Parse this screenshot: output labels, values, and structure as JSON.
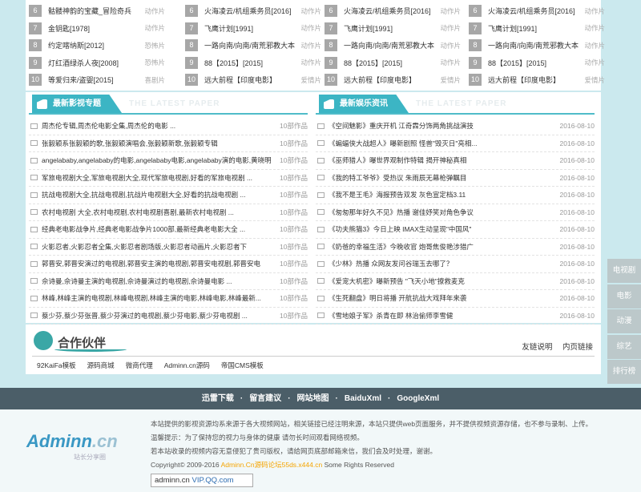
{
  "ranks": [
    [
      {
        "num": "6",
        "title": "骷髅神韵的宝藏_冒险奇兵",
        "genre": "动作片"
      },
      {
        "num": "7",
        "title": "金钥匙[1978]",
        "genre": "动作片"
      },
      {
        "num": "8",
        "title": "约定喀纳斯[2012]",
        "genre": "恐怖片"
      },
      {
        "num": "9",
        "title": "灯红酒绿杀人夜[2008]",
        "genre": "恐怖片"
      },
      {
        "num": "10",
        "title": "等爱归来/盗婴[2015]",
        "genre": "喜剧片"
      }
    ],
    [
      {
        "num": "6",
        "title": "火海凌云/机组乘务员[2016]",
        "genre": "动作片"
      },
      {
        "num": "7",
        "title": "飞鹰计划[1991]",
        "genre": "动作片"
      },
      {
        "num": "8",
        "title": "一路向南/向南/南荒邪教大本",
        "genre": "动作片"
      },
      {
        "num": "9",
        "title": "88【2015】[2015]",
        "genre": "动作片"
      },
      {
        "num": "10",
        "title": "远大前程【印度电影】",
        "genre": "爱情片"
      }
    ],
    [
      {
        "num": "6",
        "title": "火海凌云/机组乘务员[2016]",
        "genre": "动作片"
      },
      {
        "num": "7",
        "title": "飞鹰计划[1991]",
        "genre": "动作片"
      },
      {
        "num": "8",
        "title": "一路向南/向南/南荒邪教大本",
        "genre": "动作片"
      },
      {
        "num": "9",
        "title": "88【2015】[2015]",
        "genre": "动作片"
      },
      {
        "num": "10",
        "title": "远大前程【印度电影】",
        "genre": "爱情片"
      }
    ],
    [
      {
        "num": "6",
        "title": "火海凌云/机组乘务员[2016]",
        "genre": "动作片"
      },
      {
        "num": "7",
        "title": "飞鹰计划[1991]",
        "genre": "动作片"
      },
      {
        "num": "8",
        "title": "一路向南/向南/南荒邪教大本",
        "genre": "动作片"
      },
      {
        "num": "9",
        "title": "88【2015】[2015]",
        "genre": "动作片"
      },
      {
        "num": "10",
        "title": "远大前程【印度电影】",
        "genre": "爱情片"
      }
    ]
  ],
  "topics": {
    "title": "最新影视专题",
    "ghost": "THE LATEST PAPER",
    "items": [
      {
        "title": "周杰伦专辑,周杰伦电影全集,周杰伦的电影 ...",
        "meta": "10部作品"
      },
      {
        "title": "张毅颖系张毅颖的歌,张毅颖演唱会,张毅颖新歌,张毅颖专辑",
        "meta": "10部作品"
      },
      {
        "title": "angelababy,angelababy的电影,angelababy电影,angelababy演的电影,黄晓明",
        "meta": "10部作品"
      },
      {
        "title": "军旅电视剧大全,军旅电视剧大全,现代军旅电视剧,好看的军旅电视剧 ...",
        "meta": "10部作品"
      },
      {
        "title": "抗战电视剧大全,抗战电视剧,抗战片电视剧大全,好看的抗战电视剧 ...",
        "meta": "10部作品"
      },
      {
        "title": "农村电视剧 大全,农村电视剧,农村电视剧喜剧,最新农村电视剧 ...",
        "meta": "10部作品"
      },
      {
        "title": "经典老电影战争片,经典老电影战争片1000部,最新经典老电影大全 ...",
        "meta": "10部作品"
      },
      {
        "title": "火影忍者,火影忍者全集,火影忍者剧场版,火影忍者动画片,火影忍者下",
        "meta": "10部作品"
      },
      {
        "title": "郭晋安,郭晋安演过的电视剧,郭晋安主演的电视剧,郭晋安电视剧,郭晋安电",
        "meta": "10部作品"
      },
      {
        "title": "佘诗曼,佘诗曼主演的电视剧,佘诗曼演过的电视剧,佘诗曼电影 ...",
        "meta": "10部作品"
      },
      {
        "title": "林峰,林峰主演的电视剧,林峰电视剧,林峰主演的电影,林峰电影,林峰最新...",
        "meta": "10部作品"
      },
      {
        "title": "蔡少芬,蔡少芬张晋,蔡少芬演过的电视剧,蔡少芬电影,蔡少芬电视剧 ...",
        "meta": "10部作品"
      }
    ]
  },
  "news": {
    "title": "最新娱乐资讯",
    "ghost": "THE LATEST PAPER",
    "items": [
      {
        "title": "《空间魅影》重庆开机 江奇霖分饰两角挑战演技",
        "meta": "2016-08-10"
      },
      {
        "title": "《蝙蝠侠大战超人》曝新剧照 怪兽\"毁灭日\"亮相...",
        "meta": "2016-08-10"
      },
      {
        "title": "《巫师猎人》曝世界观制作特辑 揭开神秘真相",
        "meta": "2016-08-10"
      },
      {
        "title": "《我的特工爷爷》受热议 朱雨辰无幕枪弹瞩目",
        "meta": "2016-08-10"
      },
      {
        "title": "《我不是王毛》海报预告双发 灰色宣定档3.11",
        "meta": "2016-08-10"
      },
      {
        "title": "《匆匆那年好久不见》热播 谢佳妤笑对角色争议",
        "meta": "2016-08-10"
      },
      {
        "title": "《功夫熊猫3》今日上映 IMAX生动呈现\"中国风\"",
        "meta": "2016-08-10"
      },
      {
        "title": "《奶爸的幸福生活》今晚收官 炮哥焦俊艳涉猎广",
        "meta": "2016-08-10"
      },
      {
        "title": "《少林》热播 众网友发问谷瑞玉去哪了？",
        "meta": "2016-08-10"
      },
      {
        "title": "《爱宠大机密》曝新预告 \"飞天小地\"撩救麦克",
        "meta": "2016-08-10"
      },
      {
        "title": "《生死翻盘》明日将播 开航抗战大戏拜年来袭",
        "meta": "2016-08-10"
      },
      {
        "title": "《雪地娘子军》杀青在即 林治偷师李雪健",
        "meta": "2016-08-10"
      }
    ]
  },
  "partners": {
    "title": "合作伙伴",
    "links": [
      "友链说明",
      "内页链接"
    ],
    "items": [
      "92KaiFa模板",
      "源码商城",
      "微商代理",
      "Adminn.cn源码",
      "帝国CMS模板"
    ]
  },
  "side": [
    "电视剧",
    "电影",
    "动漫",
    "综艺",
    "排行榜"
  ],
  "footnav": [
    "迅雷下载",
    "留言建议",
    "网站地图",
    "BaiduXml",
    "GoogleXml"
  ],
  "footnav_sep": "·",
  "footer": {
    "logo": "Adminn",
    "logo_suffix": ".cn",
    "logo_sub": "站长分享圈",
    "lines": [
      "本站提供的影视资源均系来源于各大视频网站，相关链接已经注明来源，本站只提供web页面服务，并不提供视频资源存储，也不参与录制、上传。",
      "温馨提示：为了保持您的视力与身体的健康 请勿长时间观看网络视频。",
      "若本站收录的视频内容无意侵犯了贵司版权，请给网页底部邮箱来信，我们会及时处理，谢谢。"
    ],
    "copy_prefix": "Copyright© 2009-2016",
    "copy_highlight": "Adminn.Cn源码论坛55ds.x444.cn",
    "copy_suffix": "Some Rights Reserved",
    "badge_site": "adminn.cn",
    "badge_vip": "VIP.QQ.com"
  }
}
